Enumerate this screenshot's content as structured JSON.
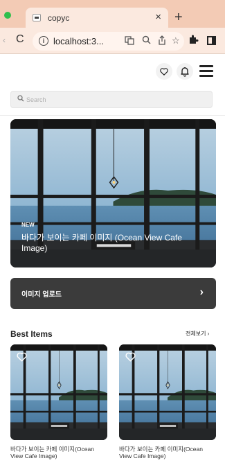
{
  "browser": {
    "tab_title": "copyc",
    "tab_close": "×",
    "new_tab": "+",
    "url": "localhost:3..."
  },
  "header": {
    "icons": [
      "heart-icon",
      "bell-icon",
      "menu-icon"
    ]
  },
  "search": {
    "placeholder": "Search"
  },
  "hero": {
    "badge": "NEW",
    "title": "바다가 보이는 카페 이미지 (Ocean View Cafe Image)"
  },
  "upload": {
    "label": "이미지 업로드",
    "chevron": "›"
  },
  "best_items": {
    "title": "Best Items",
    "see_all": "전체보기 ›",
    "items": [
      {
        "title": "바다가 보이는 카페 이미지(Ocean View Cafe Image)"
      },
      {
        "title": "바다가 보이는 카페 이미지(Ocean View Cafe Image)"
      }
    ]
  },
  "colors": {
    "tab_strip": "#f3cbb5",
    "toolbar": "#fbe9df",
    "button_dark": "#3b3b3b",
    "sky": "#9cc0d8"
  }
}
